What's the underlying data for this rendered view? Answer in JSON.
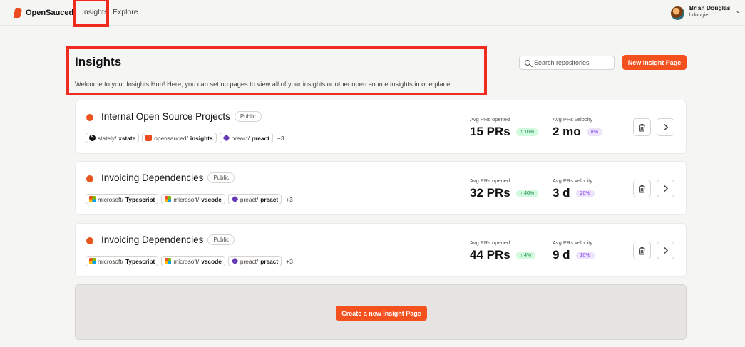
{
  "nav": {
    "brand": "OpenSauced",
    "links": [
      "Insights",
      "Explore"
    ],
    "user": {
      "name": "Brian Douglas",
      "handle": "bdougie"
    }
  },
  "header": {
    "title": "Insights",
    "description": "Welcome to your Insights Hub! Here, you can set up pages to view all of your insights or other open source insights in one place.",
    "search_placeholder": "Search repositories",
    "new_button": "New Insight Page"
  },
  "cards": [
    {
      "name": "Internal Open Source Projects",
      "visibility": "Public",
      "repos": [
        {
          "icon": "stately-icon",
          "owner": "stately/",
          "name": "xstate"
        },
        {
          "icon": "opensauced-icon",
          "owner": "opensauced/",
          "name": "insights"
        },
        {
          "icon": "preact-icon",
          "owner": "preact/",
          "name": "preact"
        }
      ],
      "more": "+3",
      "opened_label": "Avg PRs opened",
      "opened_value": "15 PRs",
      "opened_change": "↑ 10%",
      "velocity_label": "Avg PRs velocity",
      "velocity_value": "2 mo",
      "velocity_change": "8%"
    },
    {
      "name": "Invoicing Dependencies",
      "visibility": "Public",
      "repos": [
        {
          "icon": "microsoft-icon",
          "owner": "microsoft/",
          "name": "Typescript"
        },
        {
          "icon": "microsoft-icon",
          "owner": "microsoft/",
          "name": "vscode"
        },
        {
          "icon": "preact-icon",
          "owner": "preact/",
          "name": "preact"
        }
      ],
      "more": "+3",
      "opened_label": "Avg PRs opened",
      "opened_value": "32 PRs",
      "opened_change": "↑ 40%",
      "velocity_label": "Avg PRs velocity",
      "velocity_value": "3 d",
      "velocity_change": "20%"
    },
    {
      "name": "Invoicing Dependencies",
      "visibility": "Public",
      "repos": [
        {
          "icon": "microsoft-icon",
          "owner": "microsoft/",
          "name": "Typescript"
        },
        {
          "icon": "microsoft-icon",
          "owner": "microsoft/",
          "name": "vscode"
        },
        {
          "icon": "preact-icon",
          "owner": "preact/",
          "name": "preact"
        }
      ],
      "more": "+3",
      "opened_label": "Avg PRs opened",
      "opened_value": "44 PRs",
      "opened_change": "↑ 4%",
      "velocity_label": "Avg PRs velocity",
      "velocity_value": "9 d",
      "velocity_change": "10%"
    }
  ],
  "create_button": "Create a new Insight Page",
  "colors": {
    "accent": "#f4511e",
    "highlight": "#ef2a1f"
  }
}
